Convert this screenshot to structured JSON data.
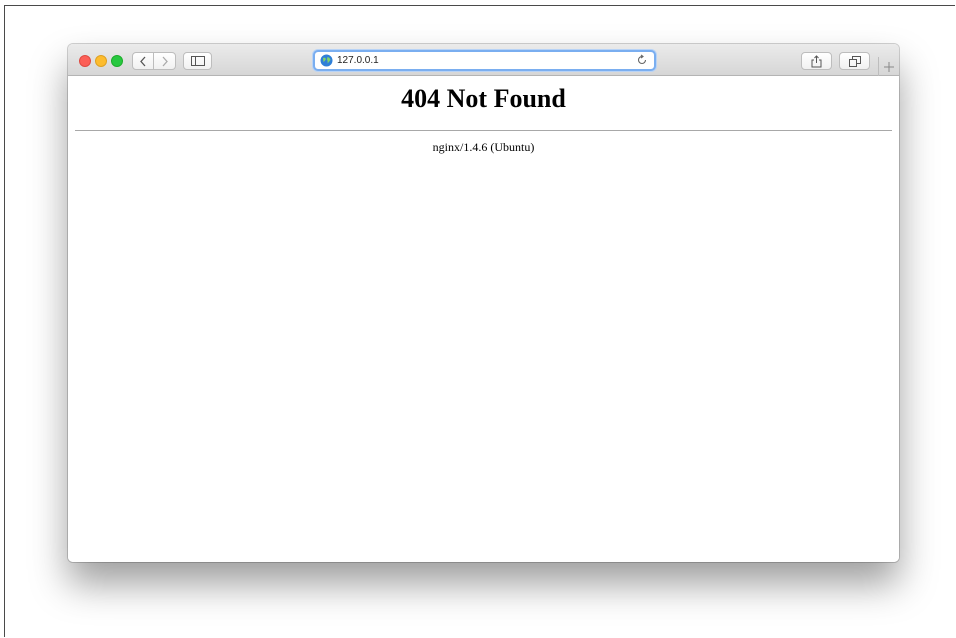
{
  "browser": {
    "address_bar": {
      "url": "127.0.0.1"
    }
  },
  "page": {
    "heading": "404 Not Found",
    "server_info": "nginx/1.4.6 (Ubuntu)"
  },
  "icons": {
    "traffic_lights": [
      "close",
      "minimize",
      "zoom"
    ],
    "toolbar": [
      "back-icon",
      "forward-icon",
      "sidebar-icon",
      "globe-icon",
      "reload-icon",
      "share-icon",
      "tabs-icon",
      "plus-icon"
    ]
  },
  "colors": {
    "close": "#fc5f57",
    "minimize": "#fdbc2e",
    "zoom": "#28c840",
    "address_focus": "#7aaef0"
  }
}
